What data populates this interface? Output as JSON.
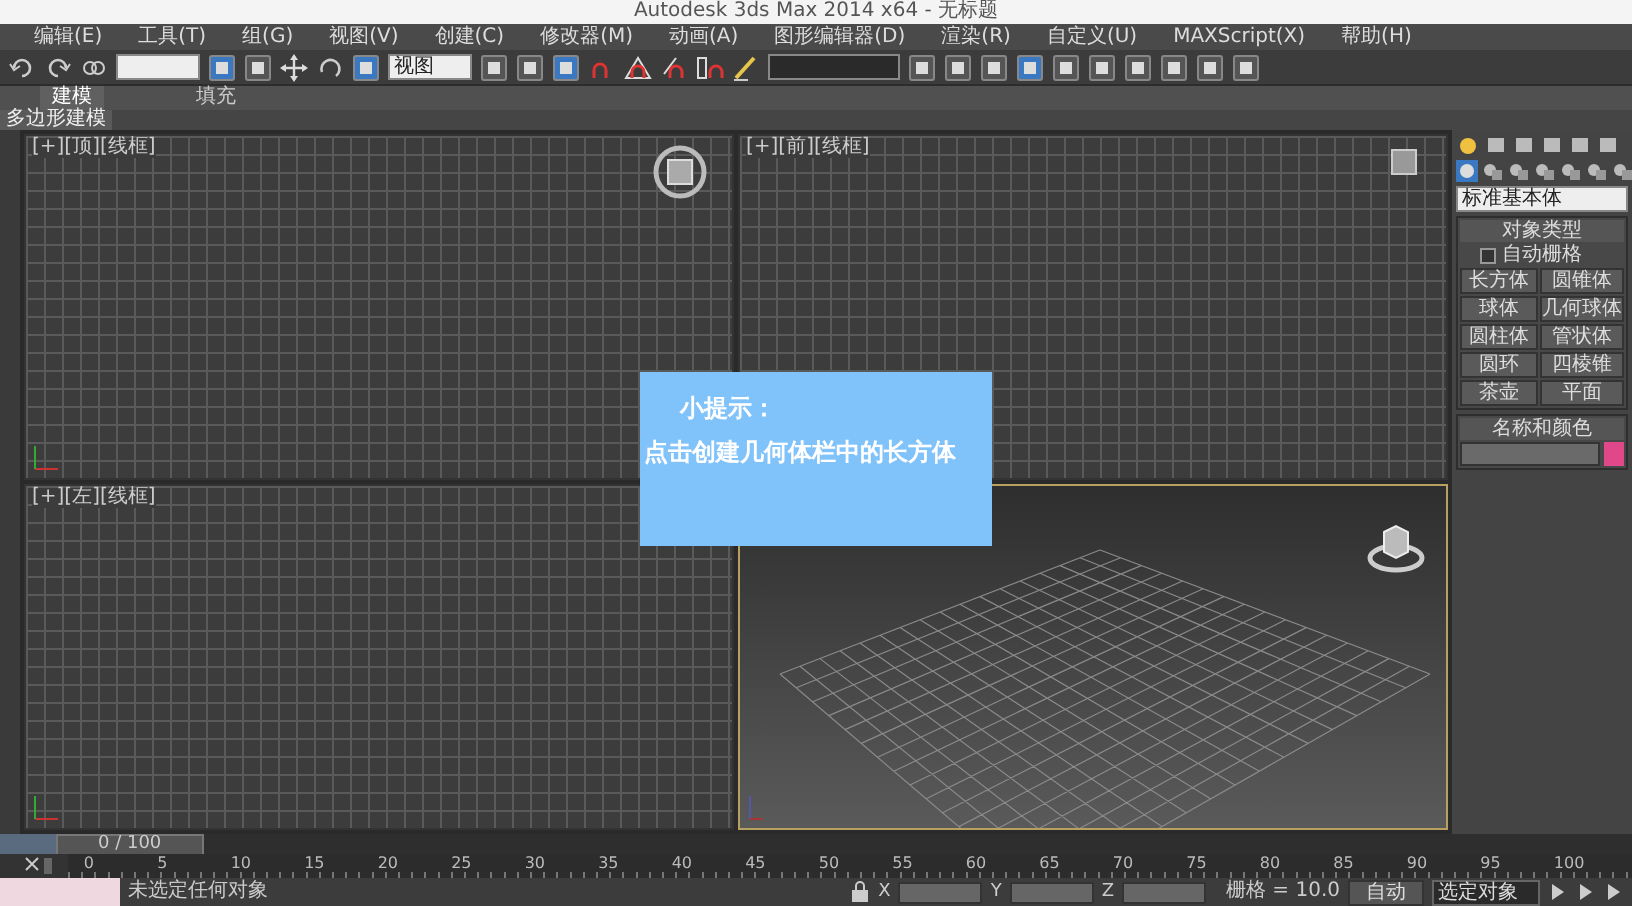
{
  "window": {
    "title": "Autodesk 3ds Max 2014 x64 - 无标题"
  },
  "menu_bar": [
    "编辑(E)",
    "工具(T)",
    "组(G)",
    "视图(V)",
    "创建(C)",
    "修改器(M)",
    "动画(A)",
    "图形编辑器(D)",
    "渲染(R)",
    "自定义(U)",
    "MAXScript(X)",
    "帮助(H)"
  ],
  "toolbar": {
    "view_dropdown": "视图"
  },
  "ribbon": {
    "tabs": [
      {
        "label": "建模",
        "selected": true
      },
      {
        "label": "填充",
        "selected": false
      }
    ],
    "subtab": "多边形建模"
  },
  "viewports": [
    {
      "kind": "ortho",
      "label": "[+][顶][线框]",
      "selected": false
    },
    {
      "kind": "ortho",
      "label": "[+][前][线框]",
      "selected": false
    },
    {
      "kind": "ortho",
      "label": "[+][左][线框]",
      "selected": false
    },
    {
      "kind": "perspective",
      "selected": true
    }
  ],
  "hint": {
    "title": "小提示：",
    "text": "点击创建几何体栏中的长方体"
  },
  "command_panel": {
    "category": "标准基本体",
    "object_type": {
      "title": "对象类型",
      "autogrid": {
        "label": "自动栅格",
        "checked": false
      },
      "buttons": [
        "长方体",
        "圆锥体",
        "球体",
        "几何球体",
        "圆柱体",
        "管状体",
        "圆环",
        "四棱锥",
        "茶壶",
        "平面"
      ]
    },
    "name_color": {
      "title": "名称和颜色",
      "color": "#e0488a"
    }
  },
  "timeline": {
    "position": "0 / 100",
    "level": 0,
    "ticks": [
      "0",
      "5",
      "10",
      "15",
      "20",
      "25",
      "30",
      "35",
      "40",
      "45",
      "50",
      "55",
      "60",
      "65",
      "70",
      "75",
      "80",
      "85",
      "90",
      "95",
      "100"
    ]
  },
  "status_bar": {
    "prompt": "未选定任何对象",
    "coords": [
      "X",
      "Y",
      "Z"
    ],
    "grid": "栅格 = 10.0",
    "auto_key": "自动",
    "key_filter": "选定对象"
  }
}
